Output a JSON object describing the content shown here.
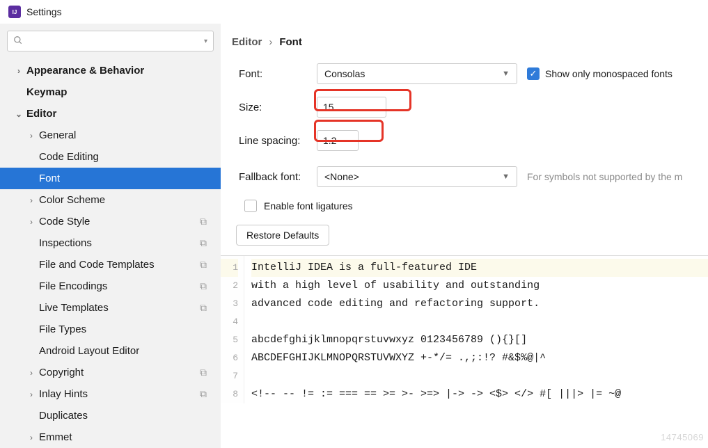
{
  "window": {
    "title": "Settings"
  },
  "search": {
    "placeholder": ""
  },
  "sidebar": {
    "items": [
      {
        "label": "Appearance & Behavior",
        "depth": 0,
        "chev": "›",
        "bold": true
      },
      {
        "label": "Keymap",
        "depth": 0,
        "chev": "",
        "bold": true
      },
      {
        "label": "Editor",
        "depth": 0,
        "chev": "⌄",
        "bold": true,
        "expanded": true
      },
      {
        "label": "General",
        "depth": 1,
        "chev": "›"
      },
      {
        "label": "Code Editing",
        "depth": 1,
        "chev": ""
      },
      {
        "label": "Font",
        "depth": 1,
        "chev": "",
        "selected": true
      },
      {
        "label": "Color Scheme",
        "depth": 1,
        "chev": "›"
      },
      {
        "label": "Code Style",
        "depth": 1,
        "chev": "›",
        "badge": "⧉"
      },
      {
        "label": "Inspections",
        "depth": 1,
        "chev": "",
        "badge": "⧉"
      },
      {
        "label": "File and Code Templates",
        "depth": 1,
        "chev": "",
        "badge": "⧉"
      },
      {
        "label": "File Encodings",
        "depth": 1,
        "chev": "",
        "badge": "⧉"
      },
      {
        "label": "Live Templates",
        "depth": 1,
        "chev": "",
        "badge": "⧉"
      },
      {
        "label": "File Types",
        "depth": 1,
        "chev": ""
      },
      {
        "label": "Android Layout Editor",
        "depth": 1,
        "chev": ""
      },
      {
        "label": "Copyright",
        "depth": 1,
        "chev": "›",
        "badge": "⧉"
      },
      {
        "label": "Inlay Hints",
        "depth": 1,
        "chev": "›",
        "badge": "⧉"
      },
      {
        "label": "Duplicates",
        "depth": 1,
        "chev": ""
      },
      {
        "label": "Emmet",
        "depth": 1,
        "chev": "›"
      }
    ]
  },
  "breadcrumb": {
    "a": "Editor",
    "sep": "›",
    "b": "Font"
  },
  "form": {
    "font_label": "Font:",
    "font_value": "Consolas",
    "mono_label": "Show only monospaced fonts",
    "size_label": "Size:",
    "size_value": "15",
    "spacing_label": "Line spacing:",
    "spacing_value": "1.2",
    "fallback_label": "Fallback font:",
    "fallback_value": "<None>",
    "fallback_hint": "For symbols not supported by the m",
    "ligatures_label": "Enable font ligatures",
    "restore_label": "Restore Defaults"
  },
  "preview": {
    "lines": [
      "IntelliJ IDEA is a full-featured IDE",
      "with a high level of usability and outstanding",
      "advanced code editing and refactoring support.",
      "",
      "abcdefghijklmnopqrstuvwxyz 0123456789 (){}[]",
      "ABCDEFGHIJKLMNOPQRSTUVWXYZ +-*/= .,;:!? #&$%@|^",
      "",
      "<!-- -- != := === == >= >- >=> |-> -> <$> </> #[ |||> |= ~@"
    ]
  },
  "watermark": "14745069"
}
